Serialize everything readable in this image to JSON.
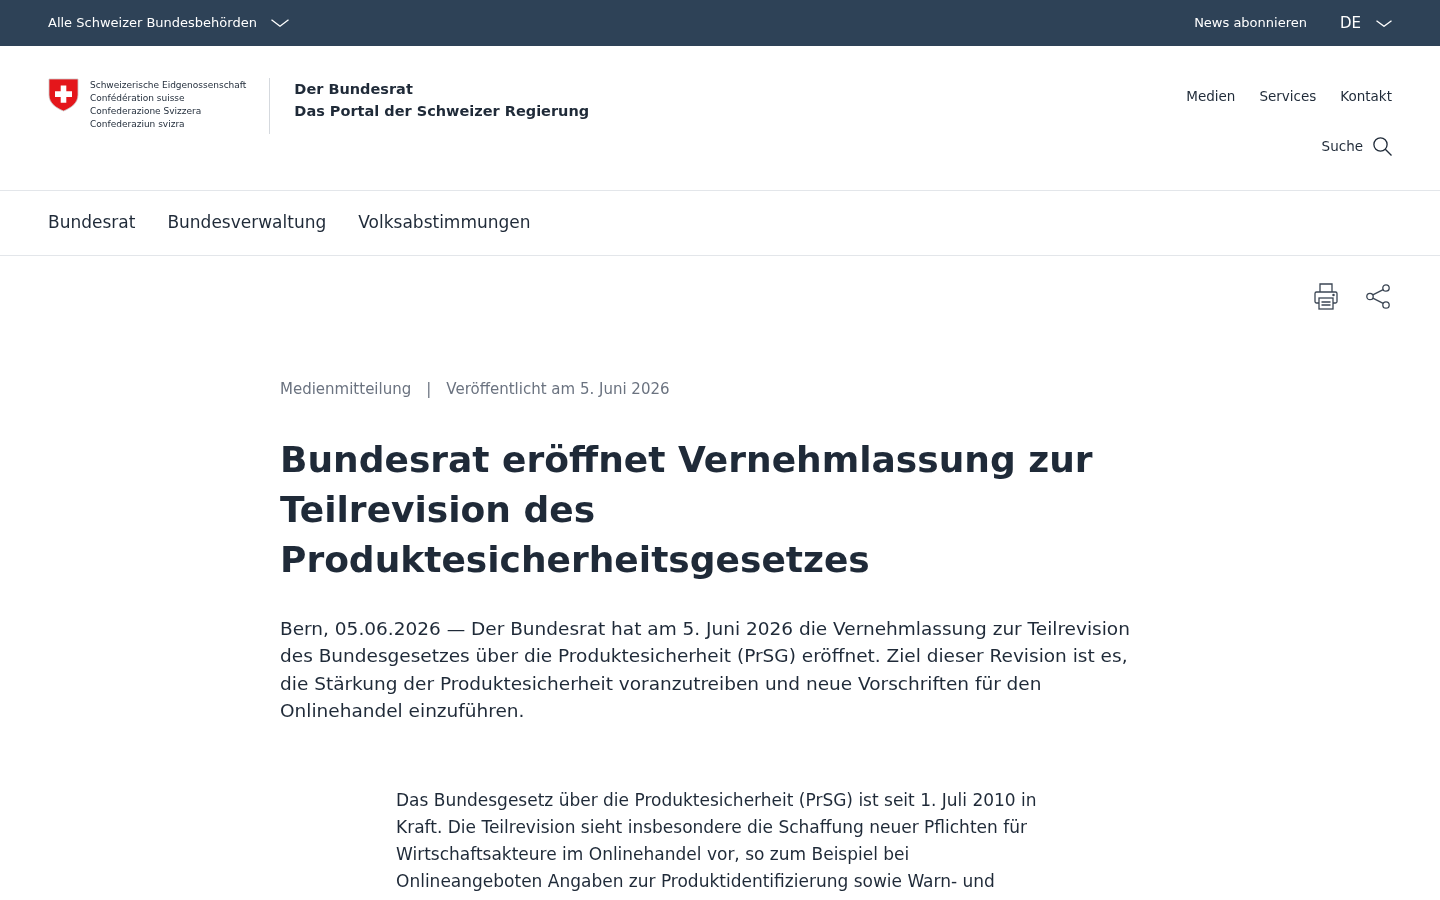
{
  "top_bar": {
    "authorities_menu": "Alle Schweizer Bundesbehörden",
    "newsletter_link": "News abonnieren",
    "language": "DE"
  },
  "header": {
    "logo_lines": [
      "Schweizerische Eidgenossenschaft",
      "Confédération suisse",
      "Confederazione Svizzera",
      "Confederaziun svizra"
    ],
    "site_title": "Der Bundesrat",
    "site_subtitle": "Das Portal der Schweizer Regierung",
    "service_links": [
      "Medien",
      "Services",
      "Kontakt"
    ],
    "search_label": "Suche"
  },
  "main_nav": [
    "Bundesrat",
    "Bundesverwaltung",
    "Volksabstimmungen"
  ],
  "article": {
    "category": "Medienmitteilung",
    "meta_separator": "|",
    "published": "Veröffentlicht am 5. Juni 2026",
    "title": "Bundesrat eröffnet Vernehmlassung zur Teilrevision des Produktesicherheitsgesetzes",
    "lead": "Bern, 05.06.2026 — Der Bundesrat hat am 5. Juni 2026 die Vernehmlassung zur Teilrevision des Bundesgesetzes über die Produktesicherheit (PrSG) eröffnet. Ziel dieser Revision ist es, die Stärkung der Produktesicherheit voranzutreiben und neue Vorschriften für den Onlinehandel einzuführen.",
    "paragraphs": [
      "Das Bundesgesetz über die Produktesicherheit (PrSG) ist seit 1. Juli 2010 in Kraft. Die Teilrevision sieht insbesondere die Schaffung neuer Pflichten für Wirtschaftsakteure im Onlinehandel vor, so zum Beispiel bei Onlineangeboten Angaben zur Produktidentifizierung sowie Warn- und"
    ]
  }
}
